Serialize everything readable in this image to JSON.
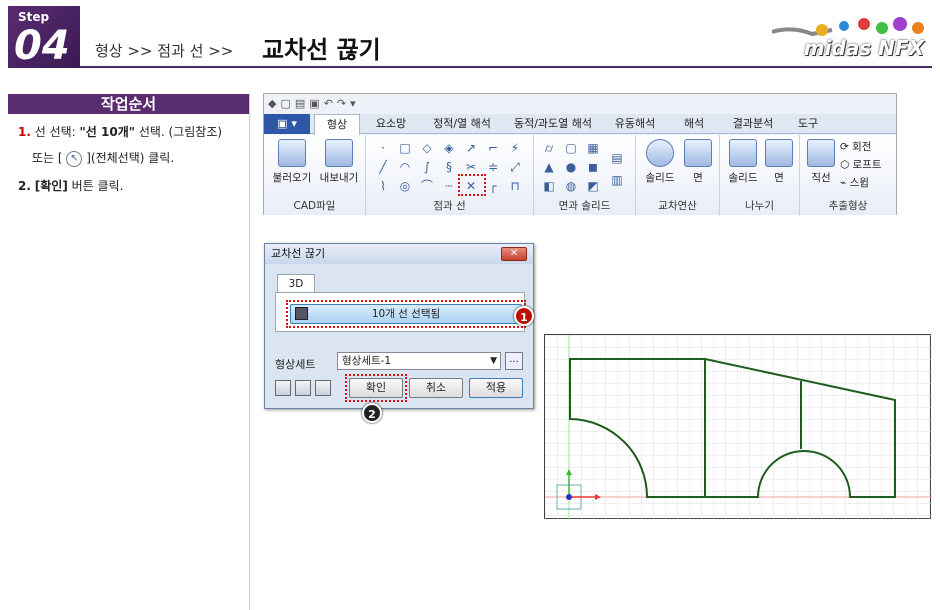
{
  "header": {
    "step_label": "Step",
    "step_number": "04",
    "breadcrumb": "형상 >> 점과 선 >>",
    "title": "교차선 끊기",
    "logo_text": "midas NFX"
  },
  "procedure": {
    "heading": "작업순서",
    "step1_num": "1.",
    "step1_a": "선 선택: ",
    "step1_bold": "\"선 10개\"",
    "step1_b": " 선택. (그림참조)",
    "step1_line2_a": "또는 [",
    "step1_line2_b": "](전체선택) 클릭.",
    "step2_num": "2.",
    "step2_bold": "[확인]",
    "step2_text": " 버튼 클릭."
  },
  "ribbon": {
    "tabs": [
      "형상",
      "요소망",
      "정적/열 해석",
      "동적/과도열 해석",
      "유동해석",
      "해석",
      "결과분석",
      "도구"
    ],
    "active_tab": "형상",
    "groups": {
      "cad": {
        "label": "CAD파일",
        "import": "불러오기",
        "export": "내보내기"
      },
      "pointline": {
        "label": "점과 선"
      },
      "surface": {
        "label": "면과 솔리드"
      },
      "boolean": {
        "label": "교차연산",
        "solid": "솔리드",
        "face": "면"
      },
      "divide": {
        "label": "나누기",
        "solid": "솔리드",
        "face": "면"
      },
      "extract": {
        "label": "추출형상",
        "line": "직선",
        "revolve": "회전",
        "loft": "로프트",
        "sweep": "스윕"
      }
    }
  },
  "dialog": {
    "title": "교차선 끊기",
    "close": "✕",
    "tab": "3D",
    "selection_button": "10개 선 선택됨",
    "shape_set_label": "형상세트",
    "shape_set_value": "형상세트-1",
    "more": "...",
    "ok": "확인",
    "cancel": "취소",
    "apply": "적용"
  },
  "callouts": {
    "one": "1",
    "two": "2"
  },
  "colors": {
    "accent": "#5a2c70",
    "line": "#1f5c1f",
    "highlight": "#dd1111"
  }
}
